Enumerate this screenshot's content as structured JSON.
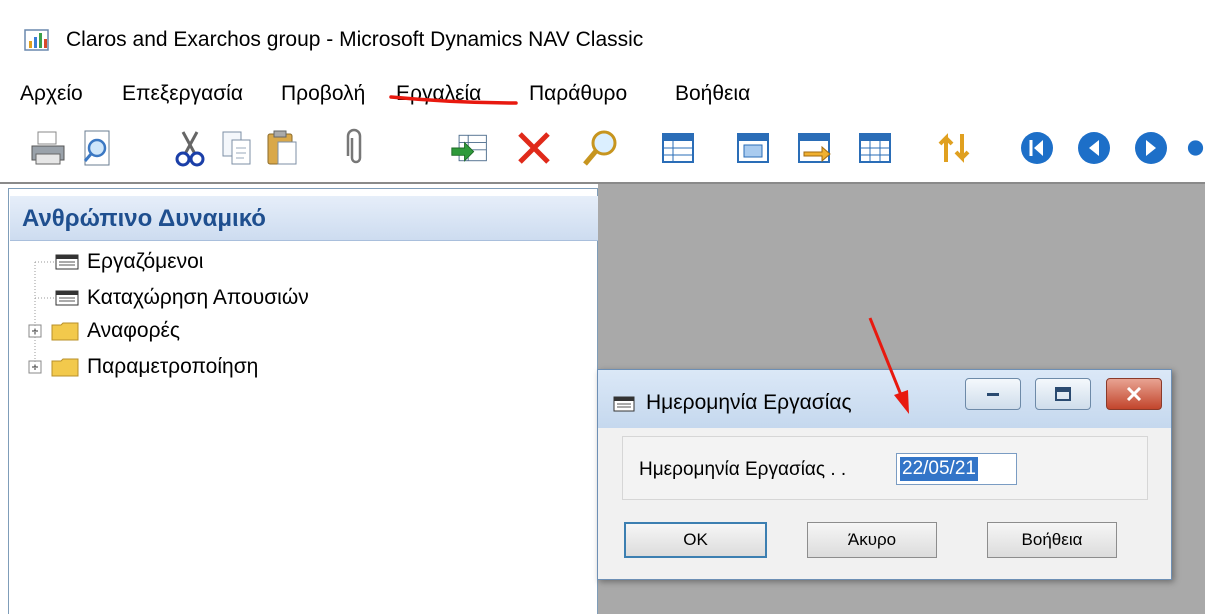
{
  "window": {
    "title": "Claros and Exarchos group - Microsoft Dynamics NAV Classic",
    "icon": "nav-app-icon"
  },
  "menu": {
    "items": [
      {
        "label": "Αρχείο"
      },
      {
        "label": "Επεξεργασία"
      },
      {
        "label": "Προβολή"
      },
      {
        "label": "Εργαλεία"
      },
      {
        "label": "Παράθυρο"
      },
      {
        "label": "Βοήθεια"
      }
    ]
  },
  "toolbar": {
    "buttons": [
      "print-icon",
      "print-preview-icon",
      "cut-icon",
      "copy-icon",
      "paste-icon",
      "attach-icon",
      "insert-record-icon",
      "delete-icon",
      "find-icon",
      "list-icon",
      "card-icon",
      "transfer-icon",
      "table-icon",
      "sort-icon",
      "first-record-icon",
      "previous-record-icon",
      "next-record-icon"
    ]
  },
  "navigation": {
    "header": "Ανθρώπινο Δυναμικό",
    "items": [
      {
        "label": "Εργαζόμενοι",
        "icon": "form-icon"
      },
      {
        "label": "Καταχώρηση Απουσιών",
        "icon": "form-icon"
      },
      {
        "label": "Αναφορές",
        "icon": "folder-icon",
        "expandable": true
      },
      {
        "label": "Παραμετροποίηση",
        "icon": "folder-icon",
        "expandable": true
      }
    ]
  },
  "dialog": {
    "title": "Ημερομηνία Εργασίας",
    "field_label": "Ημερομηνία Εργασίας . .",
    "field_value": "22/05/21",
    "buttons": {
      "ok": "OK",
      "cancel": "Άκυρο",
      "help": "Βοήθεια"
    }
  },
  "colors": {
    "annotation": "#e8190f",
    "nav_header_text": "#1f4f8f",
    "selection": "#3375c8",
    "workspace": "#a9a9a9"
  }
}
